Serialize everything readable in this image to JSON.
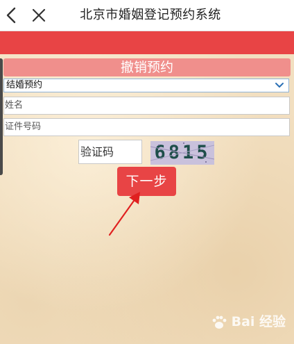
{
  "header": {
    "title": "北京市婚姻登记预约系统",
    "back_icon": "back-arrow-icon",
    "close_icon": "close-icon"
  },
  "form": {
    "section_title": "撤销预约",
    "type_select": {
      "selected": "结婚预约"
    },
    "name_field": {
      "placeholder": "姓名",
      "value": ""
    },
    "id_field": {
      "placeholder": "证件号码",
      "value": ""
    },
    "captcha_field": {
      "placeholder": "验证码",
      "value": ""
    },
    "captcha_image_text": "6815",
    "next_button_label": "下一步"
  },
  "watermark": {
    "text": "Bai 经验"
  },
  "colors": {
    "accent_red": "#e84445",
    "section_pink": "#f08f8c",
    "paper": "#f2dfc0",
    "annotation_arrow": "#e02020"
  }
}
